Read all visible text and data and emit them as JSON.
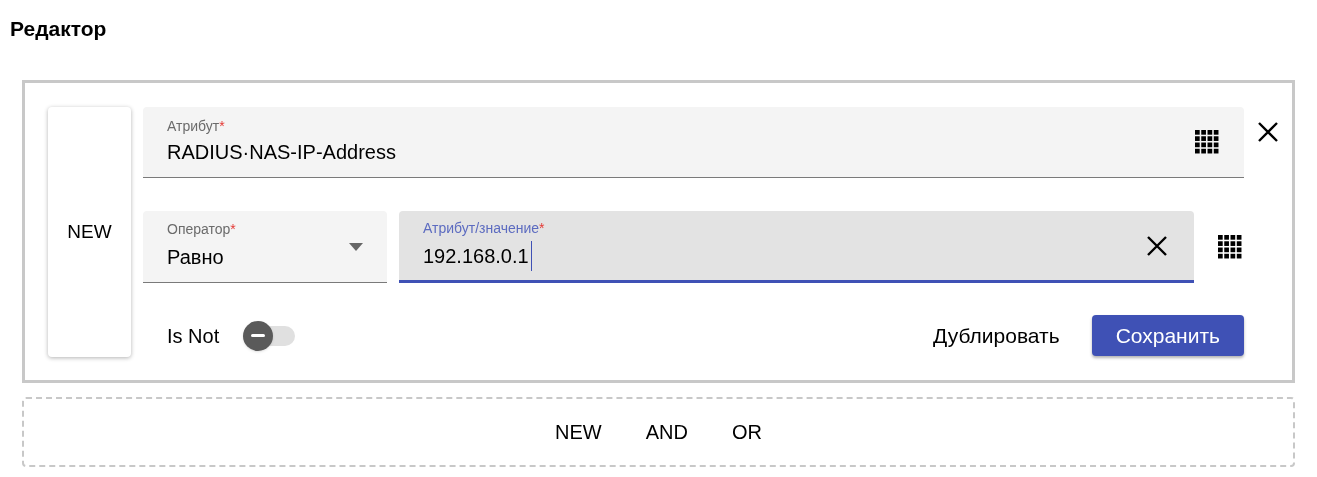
{
  "title": "Редактор",
  "rule": {
    "badge": "NEW",
    "attribute": {
      "label": "Атрибут",
      "required_mark": "*",
      "value": "RADIUS·NAS-IP-Address"
    },
    "operator": {
      "label": "Оператор",
      "required_mark": "*",
      "value": "Равно"
    },
    "value_field": {
      "label": "Атрибут/значение",
      "required_mark": "*",
      "value": "192.168.0.1",
      "focused": true
    },
    "is_not": {
      "label": "Is Not",
      "on": false
    },
    "buttons": [
      {
        "label": "Дублировать",
        "kind": "text"
      },
      {
        "label": "Сохранить",
        "kind": "primary"
      }
    ]
  },
  "add_bar": [
    "NEW",
    "AND",
    "OR"
  ]
}
